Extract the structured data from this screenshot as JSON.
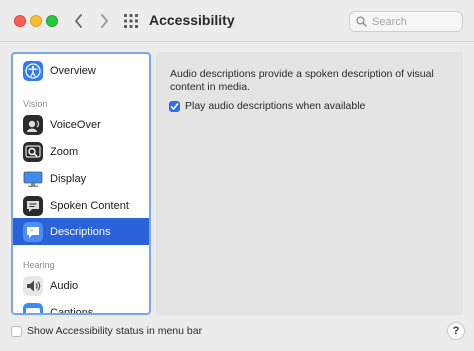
{
  "window": {
    "title": "Accessibility"
  },
  "search": {
    "placeholder": "Search"
  },
  "sidebar": {
    "overview_label": "Overview",
    "vision_header": "Vision",
    "vision_items": [
      "VoiceOver",
      "Zoom",
      "Display",
      "Spoken Content",
      "Descriptions"
    ],
    "hearing_header": "Hearing",
    "hearing_items": [
      "Audio",
      "Captions"
    ],
    "selected": "Descriptions"
  },
  "panel": {
    "description_line1": "Audio descriptions provide a spoken description of visual",
    "description_line2": "content in media.",
    "checkbox_label": "Play audio descriptions when available",
    "checkbox_checked": true
  },
  "footer": {
    "menu_bar_label": "Show Accessibility status in menu bar",
    "menu_bar_checked": false,
    "help_label": "?"
  },
  "colors": {
    "accent": "#2962d9",
    "sidebar_focus": "#7aa5e8"
  }
}
